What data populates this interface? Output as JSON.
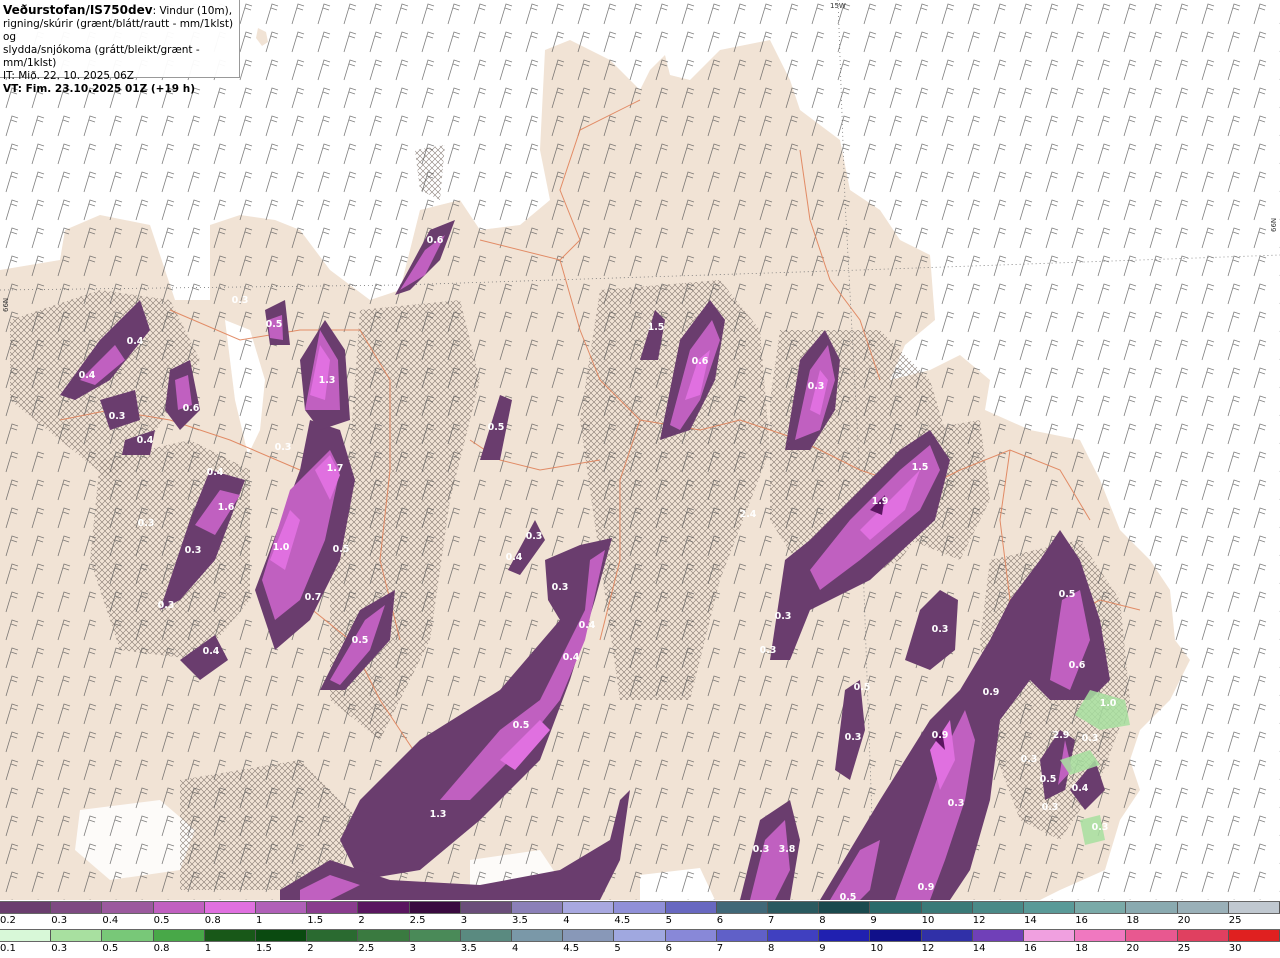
{
  "header": {
    "brand": "Veðurstofan/IS750dev",
    "desc1": ": Vindur (10m),",
    "desc2": "rigning/skúrir (grænt/blátt/rautt - mm/1klst) og",
    "desc3": "slydda/snjókoma (grátt/bleikt/grænt - mm/1klst)",
    "it": "IT: Mið. 22. 10. 2025 06Z",
    "vt": "VT: Fim. 23.10.2025 01Z (+19 h)"
  },
  "grid_labels": {
    "lon": "15W",
    "lat_left": "66N",
    "lat_right": "66N"
  },
  "precip_labels": [
    "0.6",
    "0.3",
    "0.4",
    "0.4",
    "0.5",
    "0.3",
    "0.6",
    "0.4",
    "1.3",
    "0.3",
    "0.5",
    "0.4",
    "1.7",
    "1.6",
    "0.3",
    "1.0",
    "0.3",
    "0.5",
    "0.3",
    "0.7",
    "0.4",
    "0.5",
    "0.3",
    "0.4",
    "0.3",
    "0.4",
    "0.4",
    "0.5",
    "1.3",
    "0.6",
    "1.5",
    "0.3",
    "1.5",
    "1.9",
    "2.4",
    "0.3",
    "0.3",
    "0.3",
    "0.5",
    "0.3",
    "0.5",
    "0.6",
    "0.9",
    "0.9",
    "2.9",
    "0.3",
    "0.3",
    "0.5",
    "0.4",
    "0.3",
    "0.3",
    "3.8",
    "0.9",
    "1.0",
    "0.3",
    "0.5",
    "0.3"
  ],
  "legend_snow": {
    "ticks": [
      "0.2",
      "0.3",
      "0.4",
      "0.5",
      "0.8",
      "1",
      "1.5",
      "2",
      "2.5",
      "3",
      "3.5",
      "4",
      "4.5",
      "5",
      "6",
      "7",
      "8",
      "9",
      "10",
      "12",
      "14",
      "16",
      "18",
      "20",
      "25",
      "30"
    ],
    "colors": [
      "#6a3d6e",
      "#7e4a82",
      "#9b5a9e",
      "#c060c0",
      "#e070e0",
      "#b060b8",
      "#8a3c8e",
      "#5a1660",
      "#3a0a40",
      "#6a4d7a",
      "#8b80b8",
      "#a8a8e0",
      "#9090d8",
      "#6868c0",
      "#406878",
      "#2a5a60",
      "#1a4a4e",
      "#2a6a6a",
      "#3a7a78",
      "#4a8a88",
      "#5a9a98",
      "#7aaaa8",
      "#8aaab0",
      "#9ab0b8",
      "#c0c8d0"
    ]
  },
  "legend_rain": {
    "ticks": [
      "0.1",
      "0.3",
      "0.5",
      "0.8",
      "1",
      "1.5",
      "2",
      "2.5",
      "3",
      "3.5",
      "4",
      "4.5",
      "5",
      "6",
      "7",
      "8",
      "9",
      "10",
      "12",
      "14",
      "16",
      "18",
      "20",
      "25",
      "30"
    ],
    "colors": [
      "#d8f8d8",
      "#a8e0a0",
      "#78c878",
      "#48a848",
      "#185818",
      "#0a4a10",
      "#2a6a30",
      "#3a7a40",
      "#4a8a58",
      "#5a8a80",
      "#7a98a8",
      "#8898b8",
      "#a0a8e0",
      "#8888d8",
      "#6060c8",
      "#4040c0",
      "#2020b0",
      "#10108a",
      "#3030a8",
      "#7040b8",
      "#f0a0e0",
      "#f078c0",
      "#e85890",
      "#e04060",
      "#e02020"
    ]
  }
}
